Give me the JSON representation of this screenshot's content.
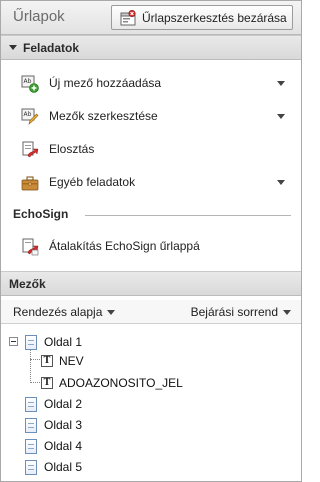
{
  "header": {
    "title": "Űrlapok",
    "close_edit_button": "Űrlapszerkesztés bezárása"
  },
  "tasks_section": {
    "title": "Feladatok",
    "items": [
      {
        "label": "Új mező hozzáadása",
        "icon": "add-field-icon",
        "has_dropdown": true
      },
      {
        "label": "Mezők szerkesztése",
        "icon": "edit-fields-icon",
        "has_dropdown": true
      },
      {
        "label": "Elosztás",
        "icon": "distribute-icon",
        "has_dropdown": false
      },
      {
        "label": "Egyéb feladatok",
        "icon": "other-tasks-icon",
        "has_dropdown": true
      }
    ]
  },
  "echosign_section": {
    "title": "EchoSign",
    "items": [
      {
        "label": "Átalakítás EchoSign űrlappá",
        "icon": "echosign-convert-icon"
      }
    ]
  },
  "fields_section": {
    "title": "Mezők",
    "sort_label": "Rendezés alapja",
    "tab_order_label": "Bejárási sorrend",
    "tree": [
      {
        "label": "Oldal 1",
        "expanded": true,
        "children": [
          "NEV",
          "ADOAZONOSITO_JEL"
        ]
      },
      {
        "label": "Oldal 2"
      },
      {
        "label": "Oldal 3"
      },
      {
        "label": "Oldal 4"
      },
      {
        "label": "Oldal 5"
      }
    ]
  },
  "colors": {
    "header_bg": "#e2e2e2",
    "section_bg": "#d9d9d9",
    "page_icon_border": "#6d8eb9"
  }
}
